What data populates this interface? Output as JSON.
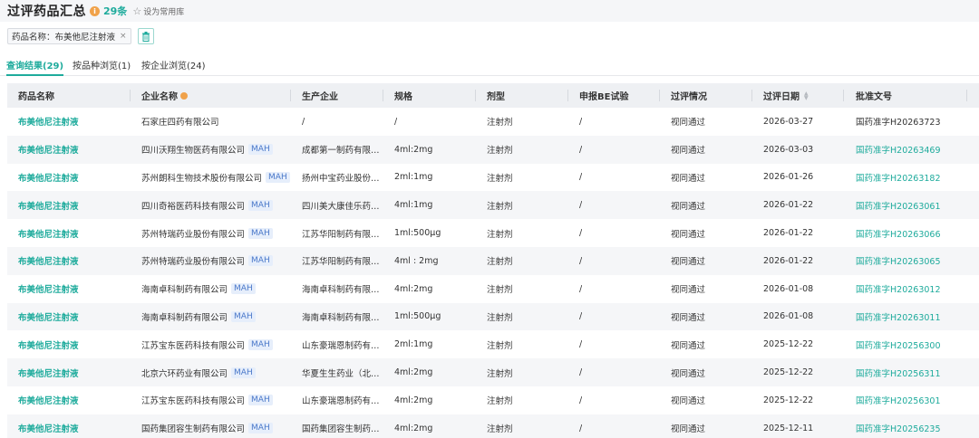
{
  "header": {
    "title": "过评药品汇总",
    "count": "29条",
    "favorite_label": "设为常用库"
  },
  "filter": {
    "chip_label": "药品名称：布美他尼注射液"
  },
  "tabs": [
    {
      "label": "查询结果(29)"
    },
    {
      "label": "按品种浏览(1)"
    },
    {
      "label": "按企业浏览(24)"
    }
  ],
  "columns": [
    "药品名称",
    "企业名称",
    "生产企业",
    "规格",
    "剂型",
    "申报BE试验",
    "过评情况",
    "过评日期",
    "批准文号"
  ],
  "mah_label": "MAH",
  "rows": [
    {
      "name": "布美他尼注射液",
      "company": "石家庄四药有限公司",
      "mah": false,
      "producer": "/",
      "spec": "/",
      "form": "注射剂",
      "be": "/",
      "status": "视同通过",
      "date": "2026-03-27",
      "approval": "国药准字H20263723",
      "approval_link": false
    },
    {
      "name": "布美他尼注射液",
      "company": "四川沃翔生物医药有限公司",
      "mah": true,
      "producer": "成都第一制药有限…",
      "spec": "4ml:2mg",
      "form": "注射剂",
      "be": "/",
      "status": "视同通过",
      "date": "2026-03-03",
      "approval": "国药准字H20263469",
      "approval_link": true
    },
    {
      "name": "布美他尼注射液",
      "company": "苏州朗科生物技术股份有限公司",
      "mah": true,
      "producer": "扬州中宝药业股份…",
      "spec": "2ml:1mg",
      "form": "注射剂",
      "be": "/",
      "status": "视同通过",
      "date": "2026-01-26",
      "approval": "国药准字H20263182",
      "approval_link": true
    },
    {
      "name": "布美他尼注射液",
      "company": "四川奇裕医药科技有限公司",
      "mah": true,
      "producer": "四川美大康佳乐药…",
      "spec": "4ml:1mg",
      "form": "注射剂",
      "be": "/",
      "status": "视同通过",
      "date": "2026-01-22",
      "approval": "国药准字H20263061",
      "approval_link": true
    },
    {
      "name": "布美他尼注射液",
      "company": "苏州特瑞药业股份有限公司",
      "mah": true,
      "producer": "江苏华阳制药有限…",
      "spec": "1ml:500μg",
      "form": "注射剂",
      "be": "/",
      "status": "视同通过",
      "date": "2026-01-22",
      "approval": "国药准字H20263066",
      "approval_link": true
    },
    {
      "name": "布美他尼注射液",
      "company": "苏州特瑞药业股份有限公司",
      "mah": true,
      "producer": "江苏华阳制药有限…",
      "spec": "4ml : 2mg",
      "form": "注射剂",
      "be": "/",
      "status": "视同通过",
      "date": "2026-01-22",
      "approval": "国药准字H20263065",
      "approval_link": true
    },
    {
      "name": "布美他尼注射液",
      "company": "海南卓科制药有限公司",
      "mah": true,
      "producer": "海南卓科制药有限…",
      "spec": "4ml:2mg",
      "form": "注射剂",
      "be": "/",
      "status": "视同通过",
      "date": "2026-01-08",
      "approval": "国药准字H20263012",
      "approval_link": true
    },
    {
      "name": "布美他尼注射液",
      "company": "海南卓科制药有限公司",
      "mah": true,
      "producer": "海南卓科制药有限…",
      "spec": "1ml:500μg",
      "form": "注射剂",
      "be": "/",
      "status": "视同通过",
      "date": "2026-01-08",
      "approval": "国药准字H20263011",
      "approval_link": true
    },
    {
      "name": "布美他尼注射液",
      "company": "江苏宝东医药科技有限公司",
      "mah": true,
      "producer": "山东豪瑞恩制药有…",
      "spec": "2ml:1mg",
      "form": "注射剂",
      "be": "/",
      "status": "视同通过",
      "date": "2025-12-22",
      "approval": "国药准字H20256300",
      "approval_link": true
    },
    {
      "name": "布美他尼注射液",
      "company": "北京六环药业有限公司",
      "mah": true,
      "producer": "华夏生生药业（北…",
      "spec": "4ml:2mg",
      "form": "注射剂",
      "be": "/",
      "status": "视同通过",
      "date": "2025-12-22",
      "approval": "国药准字H20256311",
      "approval_link": true
    },
    {
      "name": "布美他尼注射液",
      "company": "江苏宝东医药科技有限公司",
      "mah": true,
      "producer": "山东豪瑞恩制药有…",
      "spec": "4ml:2mg",
      "form": "注射剂",
      "be": "/",
      "status": "视同通过",
      "date": "2025-12-22",
      "approval": "国药准字H20256301",
      "approval_link": true
    },
    {
      "name": "布美他尼注射液",
      "company": "国药集团容生制药有限公司",
      "mah": true,
      "producer": "国药集团容生制药…",
      "spec": "4ml:2mg",
      "form": "注射剂",
      "be": "/",
      "status": "视同通过",
      "date": "2025-12-11",
      "approval": "国药准字H20256235",
      "approval_link": true
    }
  ],
  "colors": {
    "accent": "#1eab9c",
    "mah_bg": "#e6eefb",
    "mah_text": "#4a78c9",
    "header_bg": "#eef0f3",
    "info_icon": "#f0a24a"
  }
}
